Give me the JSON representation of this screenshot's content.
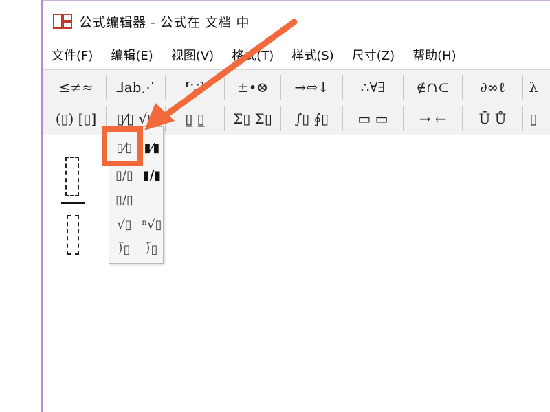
{
  "window": {
    "title": "公式编辑器 - 公式在 文档 中"
  },
  "menu": [
    "文件(F)",
    "编辑(E)",
    "视图(V)",
    "格式(T)",
    "样式(S)",
    "尺寸(Z)",
    "帮助(H)"
  ],
  "toolbar": {
    "row1": [
      "≤≠≈",
      "⅃ab⋰",
      "⸢∵⸣",
      "±•⊗",
      "→⇔↓",
      "∴∀∃",
      "∉∩⊂",
      "∂∞ℓ",
      "λ"
    ],
    "row2": [
      "(▯) [▯]",
      "▯⁄▯ √▯",
      "▯̲ ▯̲",
      "Σ▯ Σ▯",
      "∫▯ ∮▯",
      "▭ ▭",
      "→ ←",
      "Ū Ů",
      "▯"
    ]
  },
  "fraction_dropdown": {
    "items": [
      [
        "▯⁄▯",
        "▮⁄▮"
      ],
      [
        "▯/▯",
        "▮/▮"
      ],
      [
        "▯/▯",
        ""
      ],
      [
        "√▯",
        "ⁿ√▯"
      ],
      [
        "⟌▯",
        "⟌▯"
      ]
    ]
  },
  "colors": {
    "accent": "#f26a3c",
    "window_border": "#b48ed0",
    "toolbar_bg": "#f2f2f2"
  }
}
